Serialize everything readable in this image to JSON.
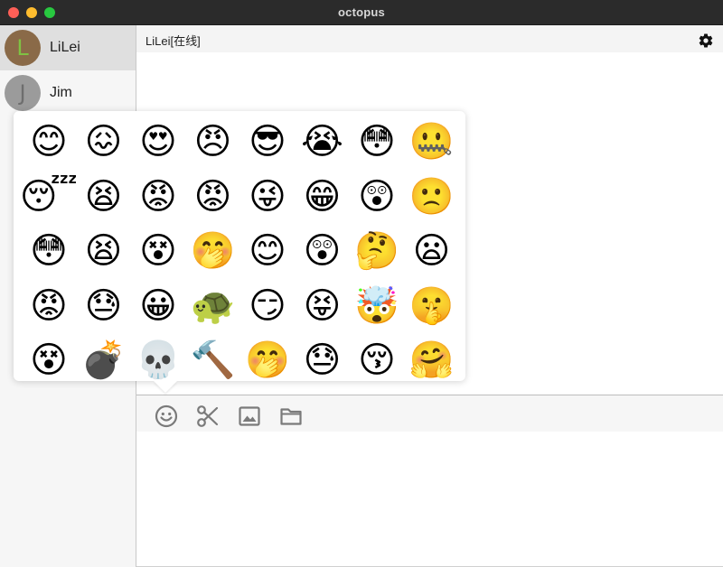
{
  "window": {
    "title": "octopus"
  },
  "contacts": [
    {
      "name": "LiLei",
      "initial": "L",
      "avatar_bg": "#8a6a48",
      "initial_color": "#7fc243"
    },
    {
      "name": "Jim",
      "initial": "J",
      "avatar_bg": "#9b9b9b",
      "initial_color": "#6e6e6e"
    }
  ],
  "chat": {
    "title": "LiLei[在线]"
  },
  "toolbar": {
    "icons": [
      "smiley-icon",
      "scissors-icon",
      "image-icon",
      "folder-icon"
    ]
  },
  "emoji_picker": {
    "emojis": [
      "😊",
      "😖",
      "😍",
      "😠",
      "😎",
      "😭",
      "😳",
      "🤐",
      "😴",
      "😫",
      "😡",
      "😡",
      "😜",
      "😁",
      "😲",
      "🙁",
      "😳",
      "😫",
      "😵",
      "🤭",
      "😊",
      "😲",
      "🤔",
      "😦",
      "😡",
      "😓",
      "😀",
      "🐢",
      "😏",
      "😝",
      "🤯",
      "🤫",
      "😵",
      "💣",
      "💀",
      "🔨",
      "🤭",
      "😓",
      "😚",
      "🤗"
    ]
  },
  "colors": {
    "titlebar": "#2b2b2b",
    "sidebar": "#f6f6f6",
    "selected_contact": "#dfdfdf",
    "icon_gray": "#7a7a7a"
  }
}
